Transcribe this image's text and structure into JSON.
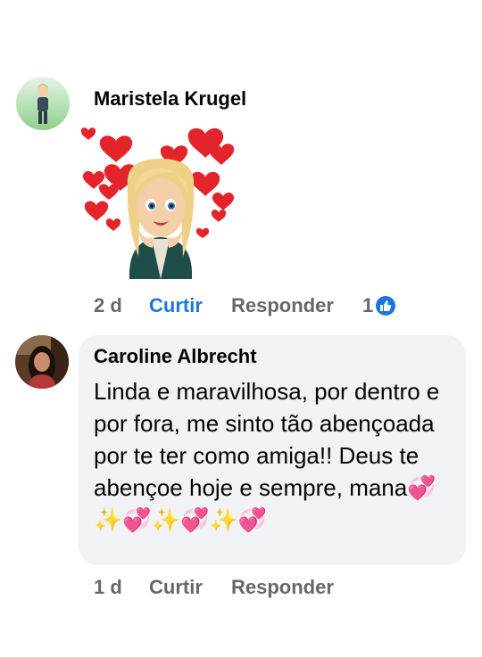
{
  "comments": [
    {
      "author": "Maristela Krugel",
      "sticker": "bitmoji-hearts-sticker",
      "time": "2 d",
      "like_label": "Curtir",
      "reply_label": "Responder",
      "reaction_count": "1",
      "reaction_icon": "thumbs-up-icon",
      "liked": true
    },
    {
      "author": "Caroline Albrecht",
      "text": "Linda e maravilhosa, por dentro e por fora, me sinto tão abençoada por te ter como amiga!! Deus te abençoe hoje e sempre, mana💞✨💞✨💞✨💞",
      "time": "1 d",
      "like_label": "Curtir",
      "reply_label": "Responder"
    }
  ],
  "colors": {
    "accent": "#1b74e4",
    "meta_text": "#65676b",
    "bubble_bg": "#f0f2f5"
  }
}
